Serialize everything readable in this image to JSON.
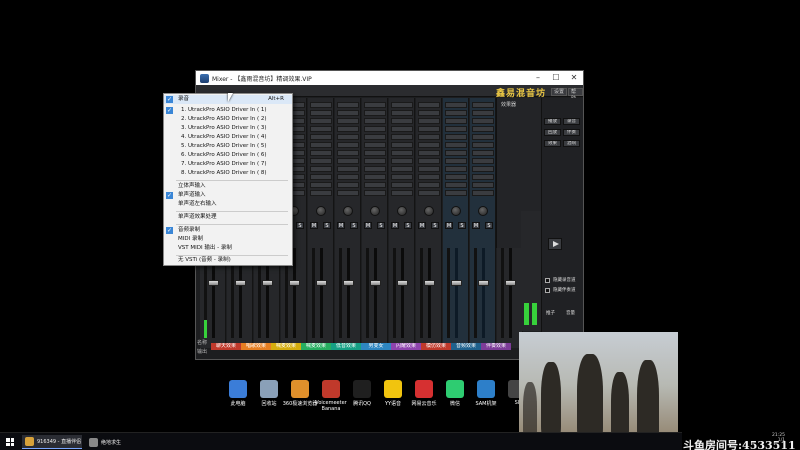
{
  "window": {
    "title": "Mixer - 【鑫雨混音坊】精调效果.VIP",
    "brand": "鑫易混音坊",
    "settings_label": "设置",
    "help_label": "帮助",
    "fx_label": "效果器"
  },
  "context_menu": {
    "items": [
      {
        "label": "录音",
        "shortcut": "Alt+R",
        "checked": true
      },
      {
        "label": "1.  UtrackPro ASIO Driver In ( 1)",
        "checked": true
      },
      {
        "label": "2.  UtrackPro ASIO Driver In ( 2)"
      },
      {
        "label": "3.  UtrackPro ASIO Driver In ( 3)"
      },
      {
        "label": "4.  UtrackPro ASIO Driver In ( 4)"
      },
      {
        "label": "5.  UtrackPro ASIO Driver In ( 5)"
      },
      {
        "label": "6.  UtrackPro ASIO Driver In ( 6)"
      },
      {
        "label": "7.  UtrackPro ASIO Driver In ( 7)"
      },
      {
        "label": "8.  UtrackPro ASIO Driver In ( 8)"
      },
      {
        "label": "立体声输入"
      },
      {
        "label": "单声道输入",
        "checked": true
      },
      {
        "label": "单声道左右输入"
      },
      {
        "label": "单声道效果处理"
      },
      {
        "label": "音频录制",
        "checked": true
      },
      {
        "label": "MIDI 录制"
      },
      {
        "label": "VST MIDI 输出 - 录制"
      },
      {
        "label": "无 VSTi (音频 - 录制)"
      }
    ]
  },
  "mixer_labels": {
    "name_row": "名称",
    "output_row": "输出"
  },
  "channels": [
    {
      "name": "聊天效果",
      "color": "#c0392b"
    },
    {
      "name": "唱歌效果",
      "color": "#e67e22"
    },
    {
      "name": "喊麦效果",
      "color": "#d4ac0d"
    },
    {
      "name": "喊麦效果",
      "color": "#27ae60"
    },
    {
      "name": "低音效果",
      "color": "#16a085"
    },
    {
      "name": "男变女",
      "color": "#2e86c1"
    },
    {
      "name": "闪耀效果",
      "color": "#8e44ad"
    },
    {
      "name": "模仿效果",
      "color": "#c0392b"
    },
    {
      "name": "音频效果",
      "color": "#1f618d"
    },
    {
      "name": "伴奏效果",
      "color": "#7d3c98"
    }
  ],
  "right_panel": {
    "buttons": [
      "播放",
      "录音",
      "回放",
      "伴奏",
      "效果",
      "混响"
    ],
    "checks": [
      "隐藏录音道",
      "隐藏伴奏道"
    ],
    "footer": [
      "推子",
      "音量"
    ]
  },
  "desktop_icons": [
    {
      "label": "此电脑",
      "color": "#3b7dd8"
    },
    {
      "label": "回收站",
      "color": "#8aa0b8"
    },
    {
      "label": "360极速浏览器",
      "color": "#e0902b"
    },
    {
      "label": "Voicemeeter Banana",
      "color": "#c0392b"
    },
    {
      "label": "腾讯QQ",
      "color": "#1f1f1f"
    },
    {
      "label": "YY语音",
      "color": "#f1c40f"
    },
    {
      "label": "网易云音乐",
      "color": "#d63031"
    },
    {
      "label": "微信",
      "color": "#2ecc71"
    },
    {
      "label": "SAM机架",
      "color": "#2d7fc9"
    },
    {
      "label": "SI",
      "color": "#444"
    }
  ],
  "taskbar": {
    "tasks": [
      {
        "label": "916349 - 直播伴侣",
        "color": "#d8a23a"
      },
      {
        "label": "绝地求生",
        "color": "#888"
      }
    ]
  },
  "stream": {
    "room_id": "斗鱼房间号:4533511",
    "time": "21:25",
    "date": "1/1"
  }
}
